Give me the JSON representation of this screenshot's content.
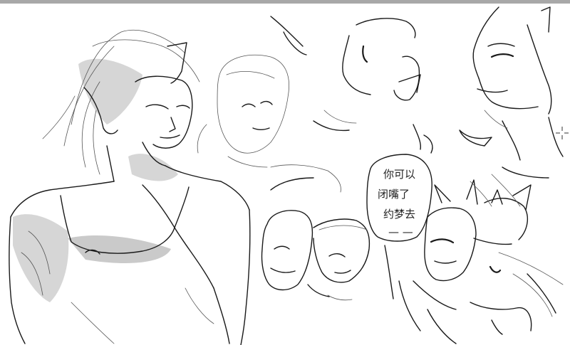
{
  "speech_bubble": {
    "lines": [
      "你可以",
      "闭嘴了",
      "约梦去",
      "— —"
    ]
  },
  "colors": {
    "background": "#ffffff",
    "top_bar": "#a8a8a8",
    "ink": "#1a1a1a",
    "shade": "#cfcfcf"
  },
  "icons": [
    "crosshair-icon"
  ]
}
